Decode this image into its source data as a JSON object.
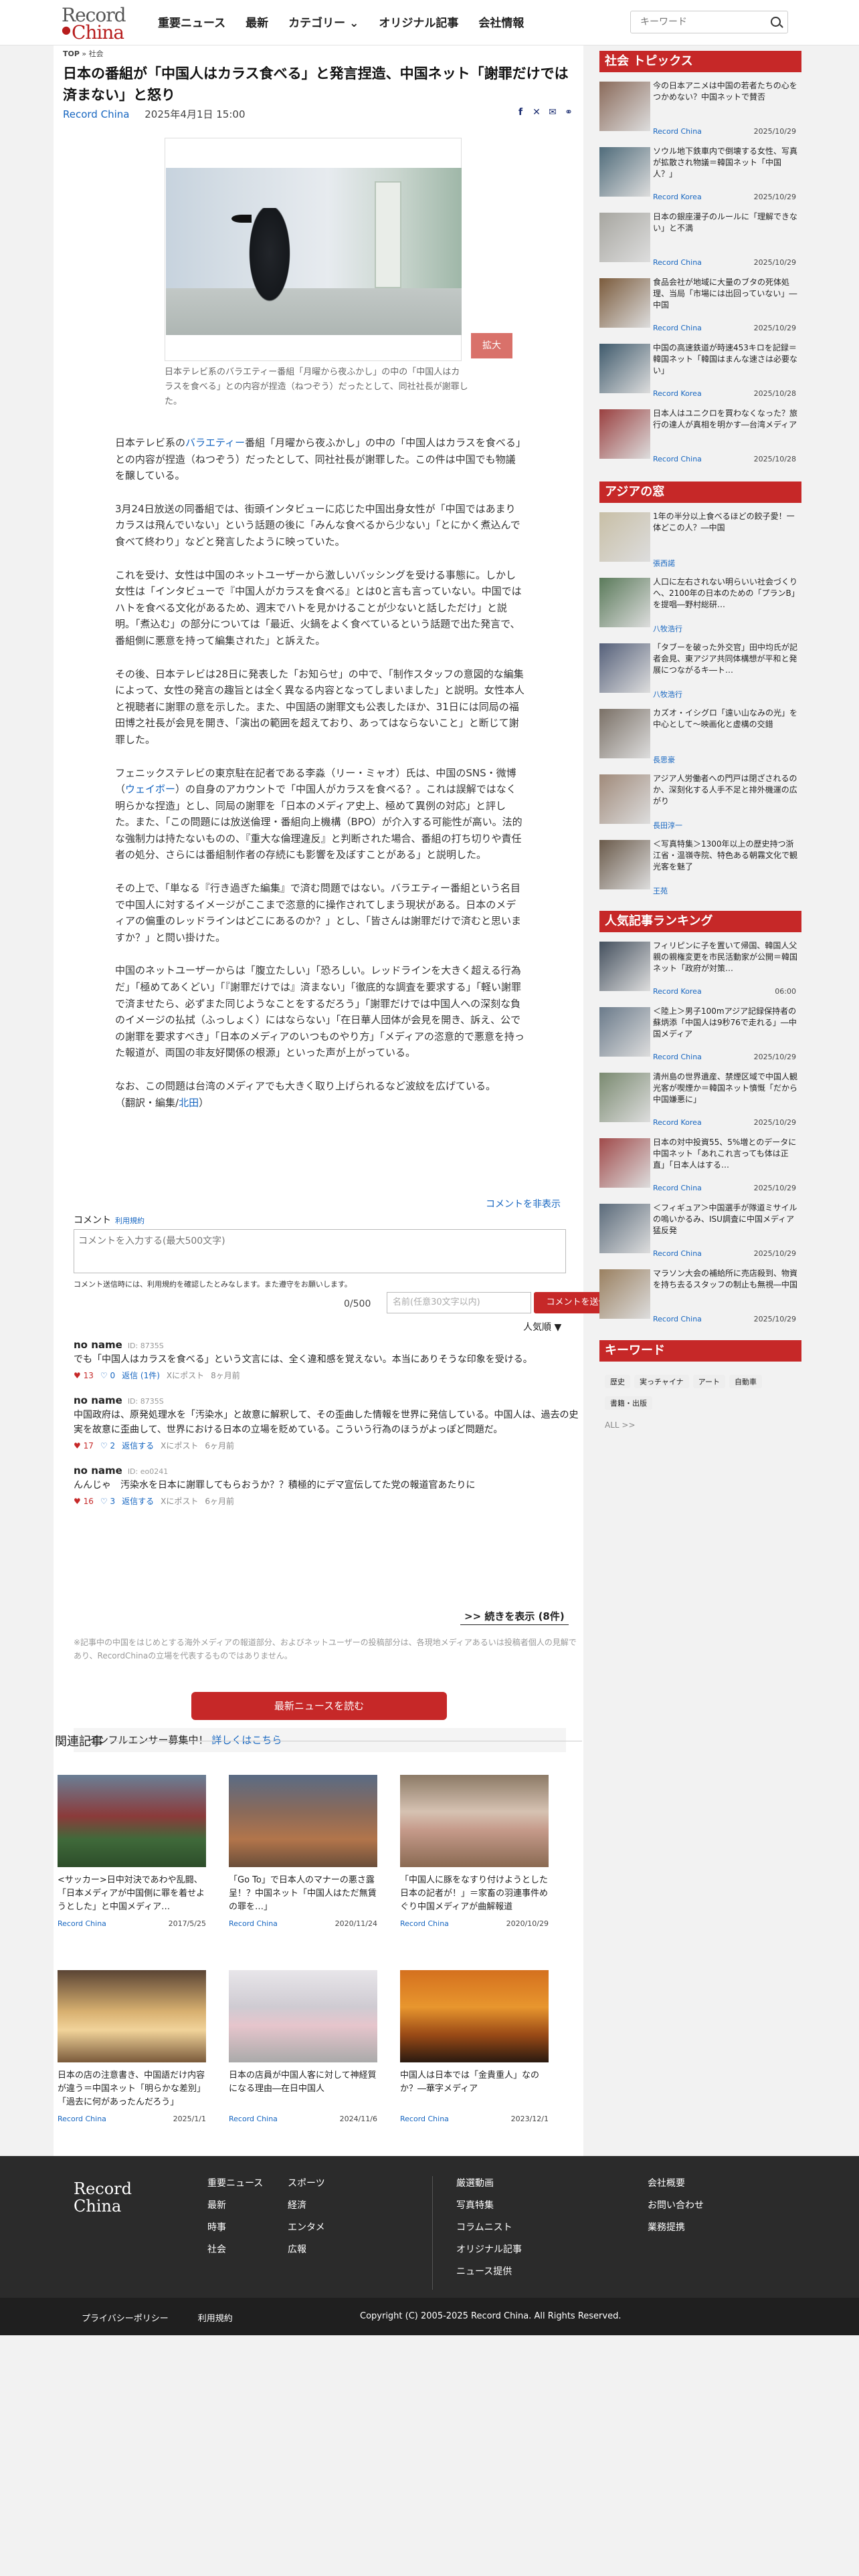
{
  "header": {
    "logo_top": "Record",
    "logo_bottom": "China",
    "nav": [
      "重要ニュース",
      "最新",
      "カテゴリー",
      "オリジナル記事",
      "会社情報"
    ],
    "search_placeholder": "キーワード"
  },
  "breadcrumb": {
    "home": "TOP",
    "current": "社会"
  },
  "article": {
    "title": "日本の番組が「中国人はカラス食べる」と発言捏造、中国ネット「謝罪だけでは済まない」と怒り",
    "source": "Record China",
    "date": "2025年4月1日 15:00",
    "zoom_label": "拡大",
    "caption": "日本テレビ系のバラエティー番組「月曜から夜ふかし」の中の「中国人はカラスを食べる」との内容が捏造（ねつぞう）だったとして、同社社長が謝罪した。",
    "paragraphs": [
      {
        "pre": "日本テレビ系の",
        "link": "バラエティー",
        "post": "番組「月曜から夜ふかし」の中の「中国人はカラスを食べる」との内容が捏造（ねつぞう）だったとして、同社社長が謝罪した。この件は中国でも物議を醸している。"
      },
      {
        "pre": "",
        "link": "",
        "post": "3月24日放送の同番組では、街頭インタビューに応じた中国出身女性が「中国ではあまりカラスは飛んでいない」という話題の後に「みんな食べるから少ない」「とにかく煮込んで食べて終わり」などと発言したように映っていた。"
      },
      {
        "pre": "",
        "link": "",
        "post": "これを受け、女性は中国のネットユーザーから激しいバッシングを受ける事態に。しかし女性は「インタビューで『中国人がカラスを食べる』とは0と言も言っていない。中国ではハトを食べる文化があるため、週末でハトを見かけることが少ないと話しただけ」と説明。「煮込む」の部分については「最近、火鍋をよく食べているという話題で出た発言で、番組側に悪意を持って編集された」と訴えた。"
      },
      {
        "pre": "",
        "link": "",
        "post": "その後、日本テレビは28日に発表した「お知らせ」の中で、「制作スタッフの意図的な編集によって、女性の発言の趣旨とは全く異なる内容となってしまいました」と説明。女性本人と視聴者に謝罪の意を示した。また、中国語の謝罪文も公表したほか、31日には同局の福田博之社長が会見を開き、「演出の範囲を超えており、あってはならないこと」と断じて謝罪した。"
      },
      {
        "pre": "フェニックステレビの東京駐在記者である李淼（リー・ミャオ）氏は、中国のSNS・微博（",
        "link": "ウェイボー",
        "post": "）の自身のアカウントで「中国人がカラスを食べる？。これは誤解ではなく明らかな捏造」とし、同局の謝罪を「日本のメディア史上、極めて異例の対応」と評した。また、「この問題には放送倫理・番組向上機構（BPO）が介入する可能性が高い。法的な強制力は持たないものの、『重大な倫理違反』と判断された場合、番組の打ち切りや責任者の処分、さらには番組制作者の存続にも影響を及ぼすことがある」と説明した。"
      },
      {
        "pre": "",
        "link": "",
        "post": "その上で、「単なる『行き過ぎた編集』で済む問題ではない。バラエティー番組という名目で中国人に対するイメージがここまで恣意的に操作されてしまう現状がある。日本のメディアの偏重のレッドラインはどこにあるのか？」とし、「皆さんは謝罪だけで済むと思いますか？」と問い掛けた。"
      },
      {
        "pre": "",
        "link": "",
        "post": "中国のネットユーザーからは「腹立たしい」「恐ろしい。レッドラインを大きく超える行為だ」「極めてあくどい」「『謝罪だけでは』済まない」「徹底的な調査を要求する」「軽い謝罪で済ませたら、必ずまた同じようなことをするだろう」「謝罪だけでは中国人への深刻な負のイメージの払拭（ふっしょく）にはならない」「在日華人団体が会見を開き、訴え、公での謝罪を要求すべき」「日本のメディアのいつものやり方」「メディアの恣意的で悪意を持った報道が、両国の非友好関係の根源」といった声が上がっている。"
      },
      {
        "pre": "",
        "link": "",
        "post": "なお、この問題は台湾のメディアでも大きく取り上げられるなど波紋を広げている。"
      }
    ],
    "credit_pre": "（翻訳・編集/",
    "credit_link": "北田",
    "credit_post": "）"
  },
  "comments": {
    "hide_label": "コメントを非表示",
    "heading": "コメント",
    "terms_link": "利用規約",
    "placeholder": "コメントを入力する(最大500文字)",
    "note": "コメント送信時には、利用規約を確認したとみなします。また遵守をお願いします。",
    "count": "0/500",
    "name_placeholder": "名前(任意30文字以内)",
    "send": "コメントを送信",
    "sort": "人気順 ▼",
    "items": [
      {
        "name": "no name",
        "id": "ID: 8735S",
        "text": "でも「中国人はカラスを食べる」という文言には、全く違和感を覚えない。本当にありそうな印象を受ける。",
        "up": "13",
        "down": "0",
        "reply": "返信 (1件)",
        "post": "Xにポスト",
        "ago": "8ヶ月前"
      },
      {
        "name": "no name",
        "id": "ID: 8735S",
        "text": "中国政府は、原発処理水を「汚染水」と故意に解釈して、その歪曲した情報を世界に発信している。中国人は、過去の史実を故意に歪曲して、世界における日本の立場を貶めている。こういう行為のほうがよっぽど問題だ。",
        "up": "17",
        "down": "2",
        "reply": "返信する",
        "post": "Xにポスト",
        "ago": "6ヶ月前"
      },
      {
        "name": "no name",
        "id": "ID: eo0241",
        "text": "んんじゃ　汚染水を日本に謝罪してもらおうか？？積極的にデマ宣伝してた党の報道官あたりに",
        "up": "16",
        "down": "3",
        "reply": "返信する",
        "post": "Xにポスト",
        "ago": "6ヶ月前"
      }
    ],
    "more": ">> 続きを表示 (8件)",
    "disclaimer": "※記事中の中国をはじめとする海外メディアの報道部分、およびネットユーザーの投稿部分は、各現地メディアあるいは投稿者個人の見解であり、RecordChinaの立場を代表するものではありません。",
    "news_button": "最新ニュースを読む",
    "influencer": "インフルエンサー募集中！",
    "influencer_link": "詳しくはこちら"
  },
  "related": {
    "title": "関連記事",
    "items": [
      {
        "title": "<サッカー>日中対決であわや乱闘、「日本メディアが中国側に罪を着せようとした」と中国メディア…",
        "src": "Record China",
        "date": "2017/5/25"
      },
      {
        "title": "「Go To」で日本人のマナーの悪さ露呈！？中国ネット「中国人はただ無賃の罪を…」",
        "src": "Record China",
        "date": "2020/11/24"
      },
      {
        "title": "「中国人に豚をなすり付けようとした日本の記者が！」＝家畜の羽連事件めぐり中国メディアが曲解報道",
        "src": "Record China",
        "date": "2020/10/29"
      },
      {
        "title": "日本の店の注意書き、中国語だけ内容が違う＝中国ネット「明らかな差別」「過去に何があったんだろう」",
        "src": "Record China",
        "date": "2025/1/1"
      },
      {
        "title": "日本の店員が中国人客に対して神経質になる理由―在日中国人",
        "src": "Record China",
        "date": "2024/11/6"
      },
      {
        "title": "中国人は日本では「金貴重人」なのか？―華字メディア",
        "src": "Record China",
        "date": "2023/12/1"
      }
    ]
  },
  "sidebar": {
    "topics_title": "社会 トピックス",
    "topics": [
      {
        "title": "今の日本アニメは中国の若者たちの心をつかめない？中国ネットで賛否",
        "src": "Record China",
        "date": "2025/10/29"
      },
      {
        "title": "ソウル地下鉄車内で倒壊する女性、写真が拡散され物議＝韓国ネット「中国人？」",
        "src": "Record Korea",
        "date": "2025/10/29"
      },
      {
        "title": "日本の銀座漫子のルールに「理解できない」と不満",
        "src": "Record China",
        "date": "2025/10/29"
      },
      {
        "title": "食品会社が地域に大量のブタの死体処理、当局「市場には出回っていない」―中国",
        "src": "Record China",
        "date": "2025/10/29"
      },
      {
        "title": "中国の高速鉄道が時速453キロを記録＝韓国ネット「韓国はまんな速さは必要ない」",
        "src": "Record Korea",
        "date": "2025/10/28"
      },
      {
        "title": "日本人はユニクロを買わなくなった？旅行の達人が真相を明かす―台湾メディア",
        "src": "Record China",
        "date": "2025/10/28"
      }
    ],
    "asia_title": "アジアの窓",
    "asia": [
      {
        "title": "1年の半分以上食べるほどの餃子愛！一体どこの人？―中国",
        "src": "張西諾"
      },
      {
        "title": "人口に左右されない明らいい社会づくりへ、2100年の日本のための「プランB」を提唱―野村総研…",
        "src": "八牧浩行"
      },
      {
        "title": "「タブーを破った外交官」田中均氏が記者会見、東アジア共同体構想が平和と発展につながるキ―ト…",
        "src": "八牧浩行"
      },
      {
        "title": "カズオ・イシグロ「遠い山なみの光」を中心として～映画化と虚構の交錯",
        "src": "長思豪"
      },
      {
        "title": "アジア人労働者への門戸は閉ざされるのか、深刻化する人手不足と排外機運の広がり",
        "src": "長田淳一"
      },
      {
        "title": "＜写真特集＞1300年以上の歴史持つ浙江省・温嶺寺院、特色ある朝霧文化で観光客を魅了",
        "src": "王苑"
      }
    ],
    "ranking_title": "人気記事ランキング",
    "ranking": [
      {
        "title": "フィリピンに子を置いて帰国、韓国人父親の親権変更を市民活動家が公開＝韓国ネット「政府が対策…",
        "src": "Record Korea",
        "date": "06:00"
      },
      {
        "title": "＜陸上＞男子100mアジア記録保持者の蘇炳添「中国人は9秒76で走れる」―中国メディア",
        "src": "Record China",
        "date": "2025/10/29"
      },
      {
        "title": "清州島の世界遺産、禁煙区域で中国人観光客が喫煙か＝韓国ネット憤慨「だから中国嫌悪に」",
        "src": "Record Korea",
        "date": "2025/10/29"
      },
      {
        "title": "日本の対中投資55、5%増とのデータに中国ネット「あれこれ言っても体は正直」「日本人はする…",
        "src": "Record China",
        "date": "2025/10/29"
      },
      {
        "title": "＜フィギュア＞中国選手が隊道ミサイルの嗚いかるみ、ISU調査に中国メディア猛反発",
        "src": "Record China",
        "date": "2025/10/29"
      },
      {
        "title": "マラソン大会の補給所に売店殺到、物資を持ち去るスタッフの制止も無視―中国",
        "src": "Record China",
        "date": "2025/10/29"
      }
    ],
    "keyword_title": "キーワード",
    "keywords": [
      "歴史",
      "実っチャイナ",
      "アート",
      "自動車",
      "書籍・出版"
    ],
    "all": "ALL >>"
  },
  "footer": {
    "logo_top": "Record",
    "logo_bottom": "China",
    "col1": [
      "重要ニュース",
      "最新",
      "時事",
      "社会"
    ],
    "col2": [
      "スポーツ",
      "経済",
      "エンタメ",
      "広報"
    ],
    "col3": [
      "厳選動画",
      "写真特集",
      "コラムニスト",
      "オリジナル記事",
      "ニュース提供"
    ],
    "col4": [
      "会社概要",
      "お問い合わせ",
      "業務提携"
    ],
    "privacy": "プライバシーポリシー",
    "terms": "利用規約",
    "copyright": "Copyright (C) 2005-2025 Record China. All Rights Reserved."
  }
}
